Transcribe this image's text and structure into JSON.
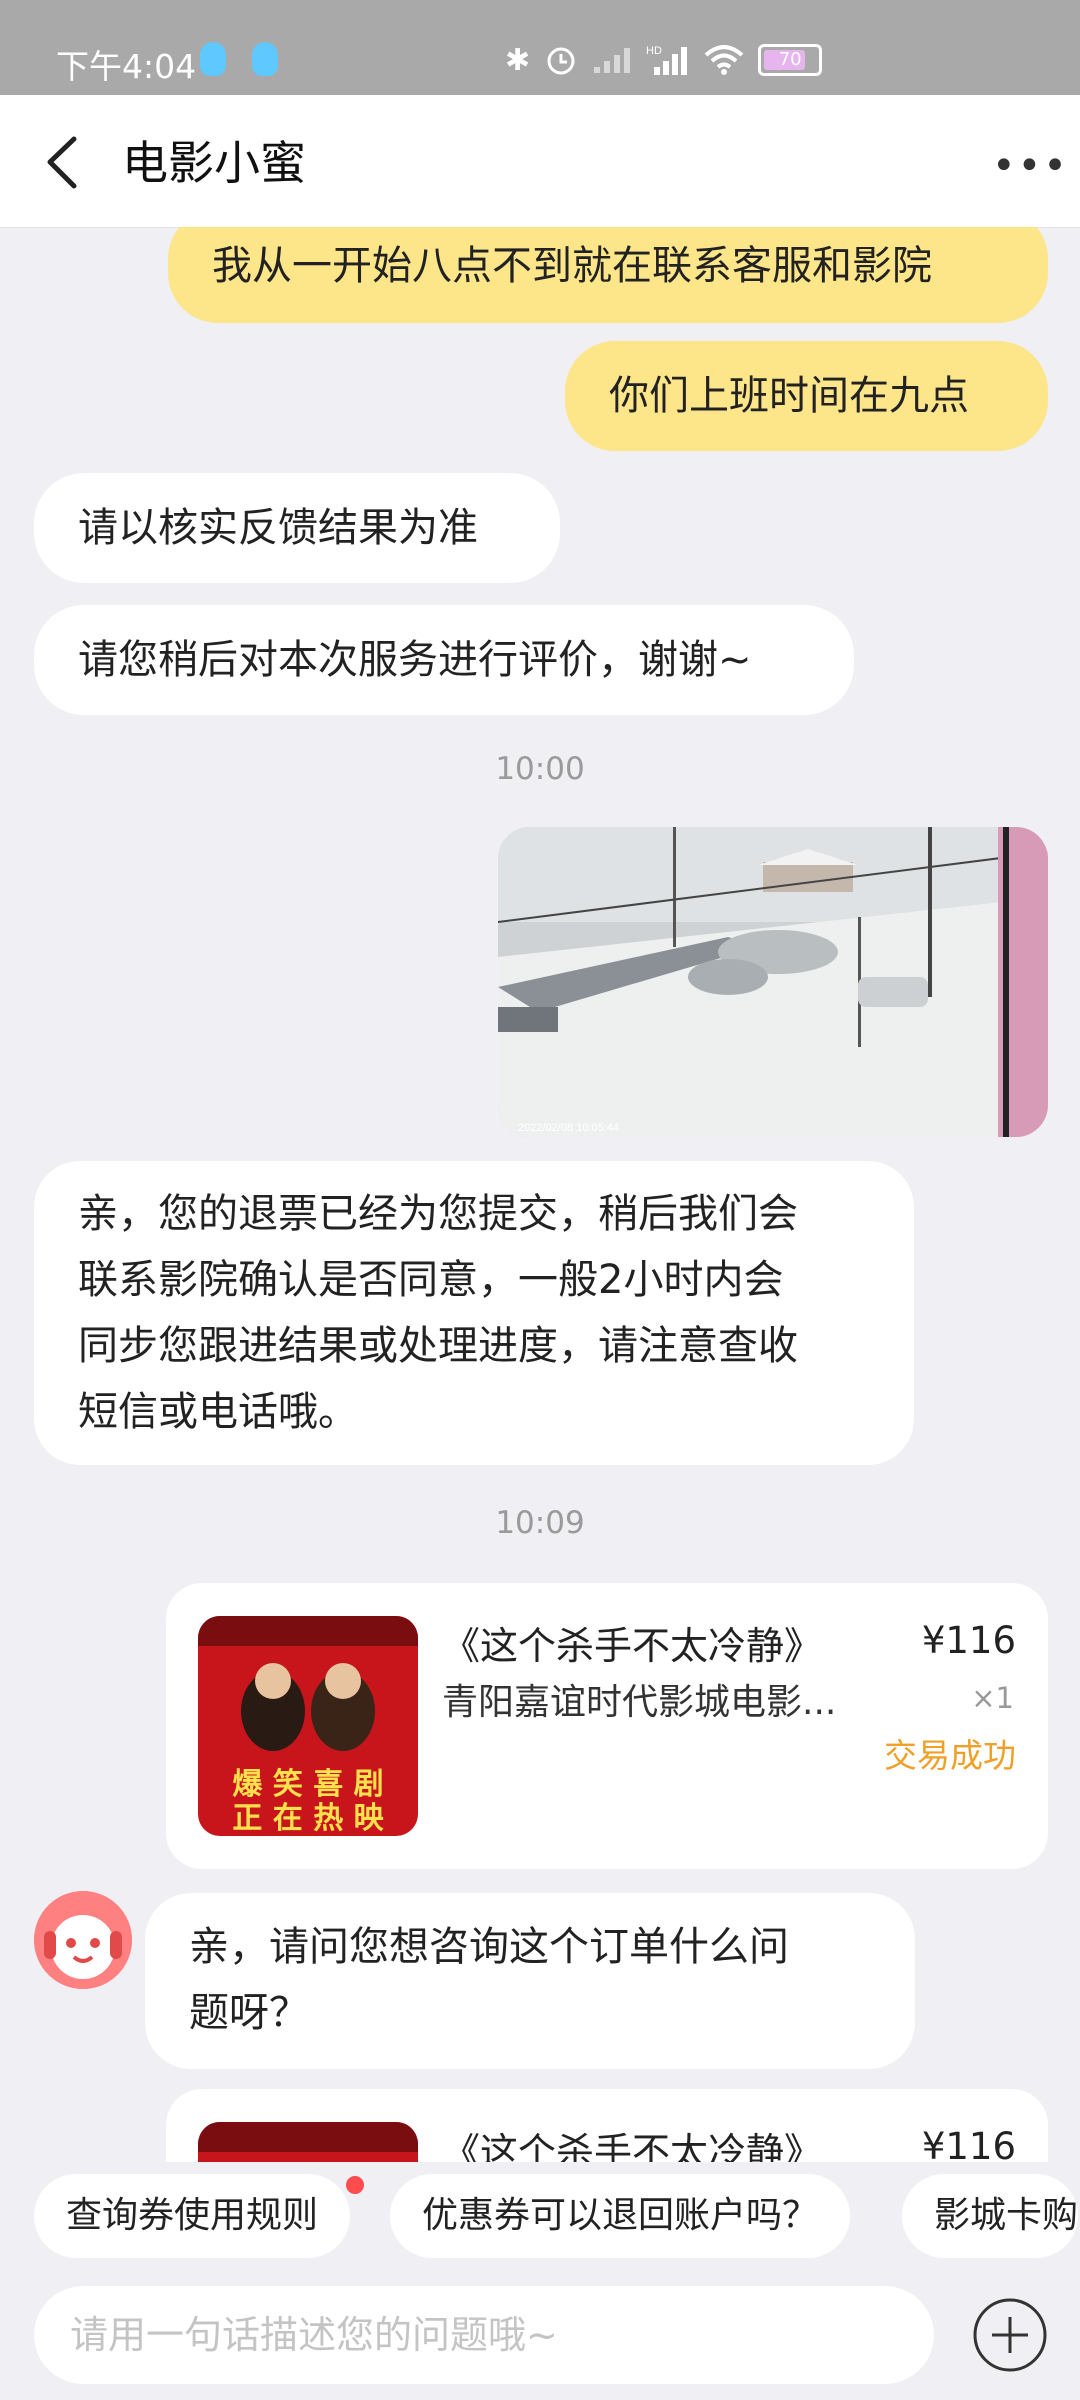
{
  "status_bar": {
    "time": "下午4:04",
    "battery": "70",
    "icons": [
      "qq-icon",
      "qq-icon",
      "bluetooth-icon",
      "alarm-icon",
      "signal-icon",
      "hd-signal-icon",
      "wifi-icon",
      "battery-icon"
    ]
  },
  "header": {
    "title": "电影小蜜"
  },
  "messages": [
    {
      "side": "out",
      "text": "我从一开始八点不到就在联系客服和影院"
    },
    {
      "side": "out",
      "text": "你们上班时间在九点"
    },
    {
      "side": "in",
      "text": "请以核实反馈结果为准"
    },
    {
      "side": "in",
      "text": "请您稍后对本次服务进行评价，谢谢~"
    },
    {
      "side": "in",
      "lines": [
        "亲，您的退票已经为您提交，稍后我们会",
        "联系影院确认是否同意，一般2小时内会",
        "同步您跟进结果或处理进度，请注意查收",
        "短信或电话哦。"
      ]
    },
    {
      "side": "in",
      "lines": [
        "亲，请问您想咨询这个订单什么问",
        "题呀？"
      ]
    }
  ],
  "timestamps": [
    "10:00",
    "10:09"
  ],
  "order": {
    "title": "《这个杀手不太冷静》",
    "cinema": "青阳嘉谊时代影城电影...",
    "price": "¥116",
    "qty": "×1",
    "status": "交易成功",
    "poster_lines": [
      "爆 笑 喜 剧",
      "正 在 热 映"
    ]
  },
  "photo": {
    "stamp": "2022/02/08 10:05:44"
  },
  "quick_replies": [
    "查询券使用规则",
    "优惠券可以退回账户吗？",
    "影城卡购"
  ],
  "input": {
    "placeholder": "请用一句话描述您的问题哦~"
  },
  "colors": {
    "out_bubble": "#fde58a",
    "in_bubble": "#ffffff",
    "status_accent": "#f0a029",
    "background": "#efeff4"
  }
}
